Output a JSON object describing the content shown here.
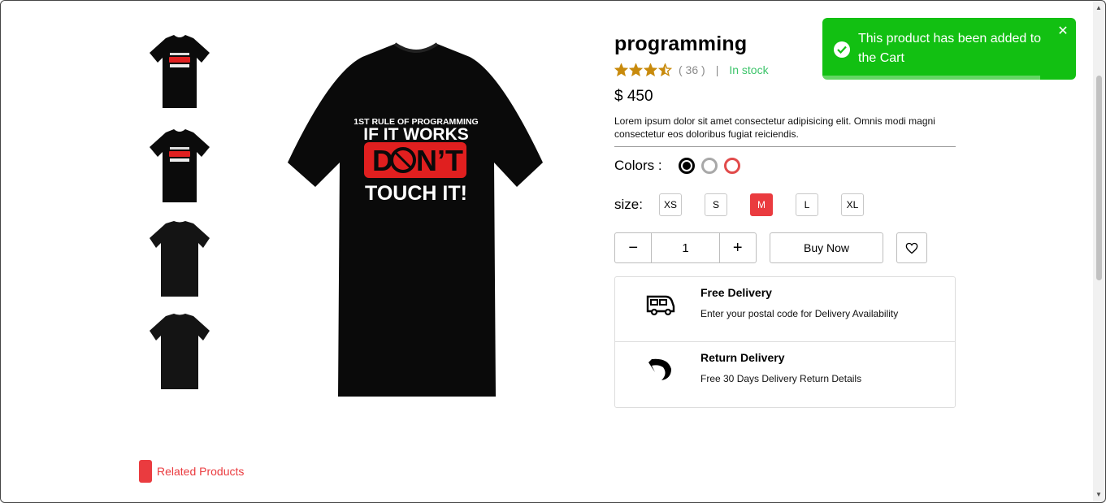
{
  "product": {
    "title": "programming",
    "review_count": "( 36 )",
    "separator": "|",
    "stock": "In stock",
    "price": "$ 450",
    "description": "Lorem ipsum dolor sit amet consectetur adipisicing elit. Omnis modi magni consectetur eos doloribus fugiat reiciendis.",
    "rating": 3.5,
    "rating_max": 5,
    "star_color": "#c88a0c"
  },
  "shirt_print": {
    "line1": "1ST RULE OF PROGRAMMING",
    "line2": "IF IT WORKS",
    "line3_pre": "D",
    "line3_post": "N’T",
    "line4": "TOUCH IT!"
  },
  "colors": {
    "label": "Colors :",
    "options": [
      {
        "name": "black",
        "hex": "#000000",
        "selected": true
      },
      {
        "name": "gray",
        "hex": "#a8a8a8",
        "selected": false
      },
      {
        "name": "red",
        "hex": "#e14b4b",
        "selected": false
      }
    ]
  },
  "sizes": {
    "label": "size:",
    "options": [
      "XS",
      "S",
      "M",
      "L",
      "XL"
    ],
    "selected": "M",
    "selected_color": "#ea3b3f"
  },
  "quantity": {
    "minus": "−",
    "value": "1",
    "plus": "+"
  },
  "actions": {
    "buy_now": "Buy Now",
    "wishlist_icon": "heart-icon"
  },
  "delivery": [
    {
      "title": "Free Delivery",
      "subtitle": "Enter your postal code for Delivery Availability",
      "icon": "truck-icon"
    },
    {
      "title": "Return Delivery",
      "subtitle": "Free 30 Days Delivery Return Details",
      "icon": "return-icon"
    }
  ],
  "related": {
    "label": "Related Products"
  },
  "toast": {
    "message": "This product has been added to the Cart",
    "close": "✕",
    "color": "#12c012",
    "progress_fraction": 0.86
  },
  "scrollbar": {
    "up": "▲",
    "down": "▼"
  }
}
